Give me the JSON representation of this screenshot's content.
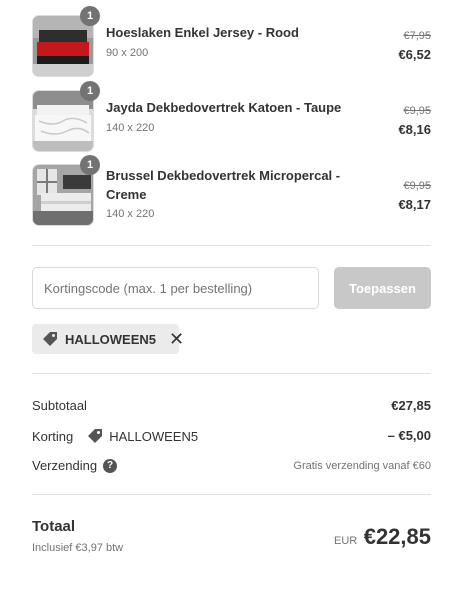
{
  "cart": {
    "items": [
      {
        "quantity": "1",
        "name": "Hoeslaken Enkel Jersey - Rood",
        "variant": "90 x 200",
        "price_old": "€7,95",
        "price_new": "€6,52",
        "image_icon": "bed-red-sheet-image"
      },
      {
        "quantity": "1",
        "name": "Jayda Dekbedovertrek Katoen - Taupe",
        "variant": "140 x 220",
        "price_old": "€9,95",
        "price_new": "€8,16",
        "image_icon": "bed-white-duvet-image"
      },
      {
        "quantity": "1",
        "name": "Brussel Dekbedovertrek Micropercal - Creme",
        "variant": "140 x 220",
        "price_old": "€9,95",
        "price_new": "€8,17",
        "image_icon": "bedroom-cream-duvet-image"
      }
    ]
  },
  "discount": {
    "placeholder": "Kortingscode (max. 1 per bestelling)",
    "apply_label": "Toepassen",
    "applied_code": "HALLOWEEN5"
  },
  "summary": {
    "subtotal_label": "Subtotaal",
    "subtotal_value": "€27,85",
    "discount_label": "Korting",
    "discount_code": "HALLOWEEN5",
    "discount_value": "– €5,00",
    "shipping_label": "Verzending",
    "shipping_note": "Gratis verzending vanaf €60"
  },
  "total": {
    "label": "Totaal",
    "tax_note": "Inclusief €3,97 btw",
    "currency": "EUR",
    "value": "€22,85"
  },
  "colors": {
    "text": "#333333",
    "muted": "#737373",
    "badge": "#737373",
    "button_disabled": "#c8c8c8",
    "chip_bg": "#ebebeb"
  }
}
